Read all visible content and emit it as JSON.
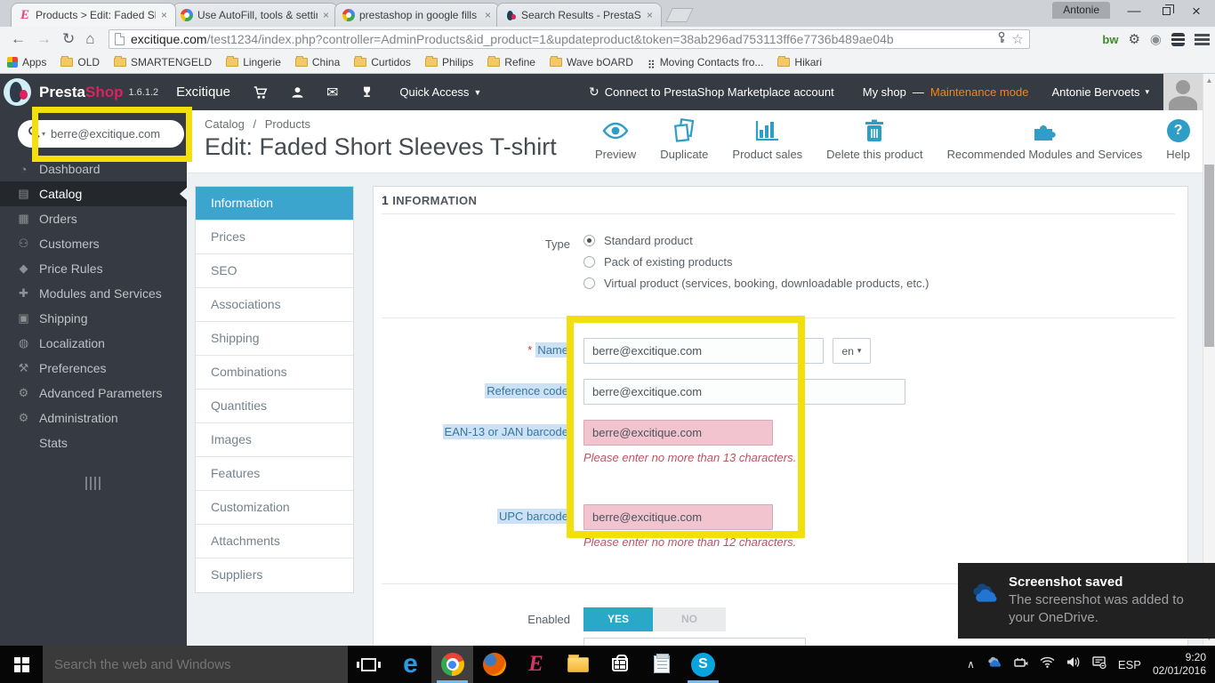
{
  "browser": {
    "profile_name": "Antonie",
    "tabs": [
      {
        "title": "Products > Edit: Faded Sho",
        "favicon": "excitique-e-icon"
      },
      {
        "title": "Use AutoFill, tools & settin",
        "favicon": "google-icon"
      },
      {
        "title": "prestashop in google fills",
        "favicon": "google-icon"
      },
      {
        "title": "Search Results - PrestaSho",
        "favicon": "prestashop-icon"
      }
    ],
    "url_domain": "excitique.com",
    "url_path": "/test1234/index.php?controller=AdminProducts&id_product=1&updateproduct&token=38ab296ad753113ff6e7736b489ae04b",
    "extension_bw": "bw",
    "bookmarks": [
      {
        "label": "Apps",
        "icon": "apps-grid-icon"
      },
      {
        "label": "OLD",
        "icon": "folder-icon"
      },
      {
        "label": "SMARTENGELD",
        "icon": "folder-icon"
      },
      {
        "label": "Lingerie",
        "icon": "folder-icon"
      },
      {
        "label": "China",
        "icon": "folder-icon"
      },
      {
        "label": "Curtidos",
        "icon": "folder-icon"
      },
      {
        "label": "Philips",
        "icon": "folder-icon"
      },
      {
        "label": "Refine",
        "icon": "folder-icon"
      },
      {
        "label": "Wave bOARD",
        "icon": "folder-icon"
      },
      {
        "label": "Moving Contacts fro...",
        "icon": "blackberry-icon"
      },
      {
        "label": "Hikari",
        "icon": "folder-icon"
      }
    ]
  },
  "ps_header": {
    "brand_presta": "Presta",
    "brand_shop": "Shop",
    "version": "1.6.1.2",
    "shop_name": "Excitique",
    "quick_access": "Quick Access",
    "marketplace": "Connect to PrestaShop Marketplace account",
    "my_shop": "My shop",
    "separator": "—",
    "maintenance": "Maintenance mode",
    "user_name": "Antonie Bervoets"
  },
  "sidebar": {
    "search_value": "berre@excitique.com",
    "items": [
      {
        "label": "Dashboard",
        "glyph": "◔"
      },
      {
        "label": "Catalog",
        "glyph": "▤"
      },
      {
        "label": "Orders",
        "glyph": "▦"
      },
      {
        "label": "Customers",
        "glyph": "⚇"
      },
      {
        "label": "Price Rules",
        "glyph": "◆"
      },
      {
        "label": "Modules and Services",
        "glyph": "✚"
      },
      {
        "label": "Shipping",
        "glyph": "▣"
      },
      {
        "label": "Localization",
        "glyph": "◍"
      },
      {
        "label": "Preferences",
        "glyph": "⚒"
      },
      {
        "label": "Advanced Parameters",
        "glyph": "⚙"
      },
      {
        "label": "Administration",
        "glyph": "⚙"
      },
      {
        "label": "Stats",
        "glyph": ""
      }
    ]
  },
  "page": {
    "breadcrumb_1": "Catalog",
    "breadcrumb_sep": "/",
    "breadcrumb_2": "Products",
    "title": "Edit: Faded Short Sleeves T-shirt",
    "actions": [
      {
        "label": "Preview"
      },
      {
        "label": "Duplicate"
      },
      {
        "label": "Product sales"
      },
      {
        "label": "Delete this product"
      },
      {
        "label": "Recommended Modules and Services"
      },
      {
        "label": "Help"
      }
    ]
  },
  "product_tabs": [
    "Information",
    "Prices",
    "SEO",
    "Associations",
    "Shipping",
    "Combinations",
    "Quantities",
    "Images",
    "Features",
    "Customization",
    "Attachments",
    "Suppliers"
  ],
  "form": {
    "section_number": "1",
    "section_title": "INFORMATION",
    "type_label": "Type",
    "type_options": [
      "Standard product",
      "Pack of existing products",
      "Virtual product (services, booking, downloadable products, etc.)"
    ],
    "required_mark": "*",
    "name_label": "Name",
    "name_value": "berre@excitique.com",
    "lang_code": "en",
    "reference_label": "Reference code",
    "reference_value": "berre@excitique.com",
    "ean_label": "EAN-13 or JAN barcode",
    "ean_value": "berre@excitique.com",
    "ean_error": "Please enter no more than 13 characters.",
    "upc_label": "UPC barcode",
    "upc_value": "berre@excitique.com",
    "upc_error": "Please enter no more than 12 characters.",
    "enabled_label": "Enabled",
    "yes_label": "YES",
    "no_label": "NO"
  },
  "toast": {
    "title": "Screenshot saved",
    "body": "The screenshot was added to your OneDrive."
  },
  "taskbar": {
    "search_placeholder": "Search the web and Windows",
    "tray_lang": "ESP",
    "tray_time": "9:20",
    "tray_date": "02/01/2016"
  },
  "colors": {
    "accent_blue": "#3ca5ce",
    "brand_pink": "#e0205e",
    "maintenance_orange": "#f7840c",
    "error_red": "#bf5160",
    "invalid_pink": "#f2c4d0",
    "highlight_yellow": "#f3df0c",
    "toggle_teal": "#29a8c8"
  },
  "icons": {
    "caret_down": "▾",
    "quick_caret": "▼",
    "chevron_up": "∧",
    "star": "☆",
    "envelope": "✉",
    "home": "⌂",
    "reload": "↻",
    "back": "←",
    "forward": "→",
    "gear": "⚙",
    "reel": "◉",
    "marketplace": "↻",
    "window_minimize": "—",
    "window_close": "×",
    "scroll_up": "▲",
    "scroll_down": "▼",
    "close_tab": "×",
    "help_q": "?",
    "blackberry": "⣶"
  }
}
